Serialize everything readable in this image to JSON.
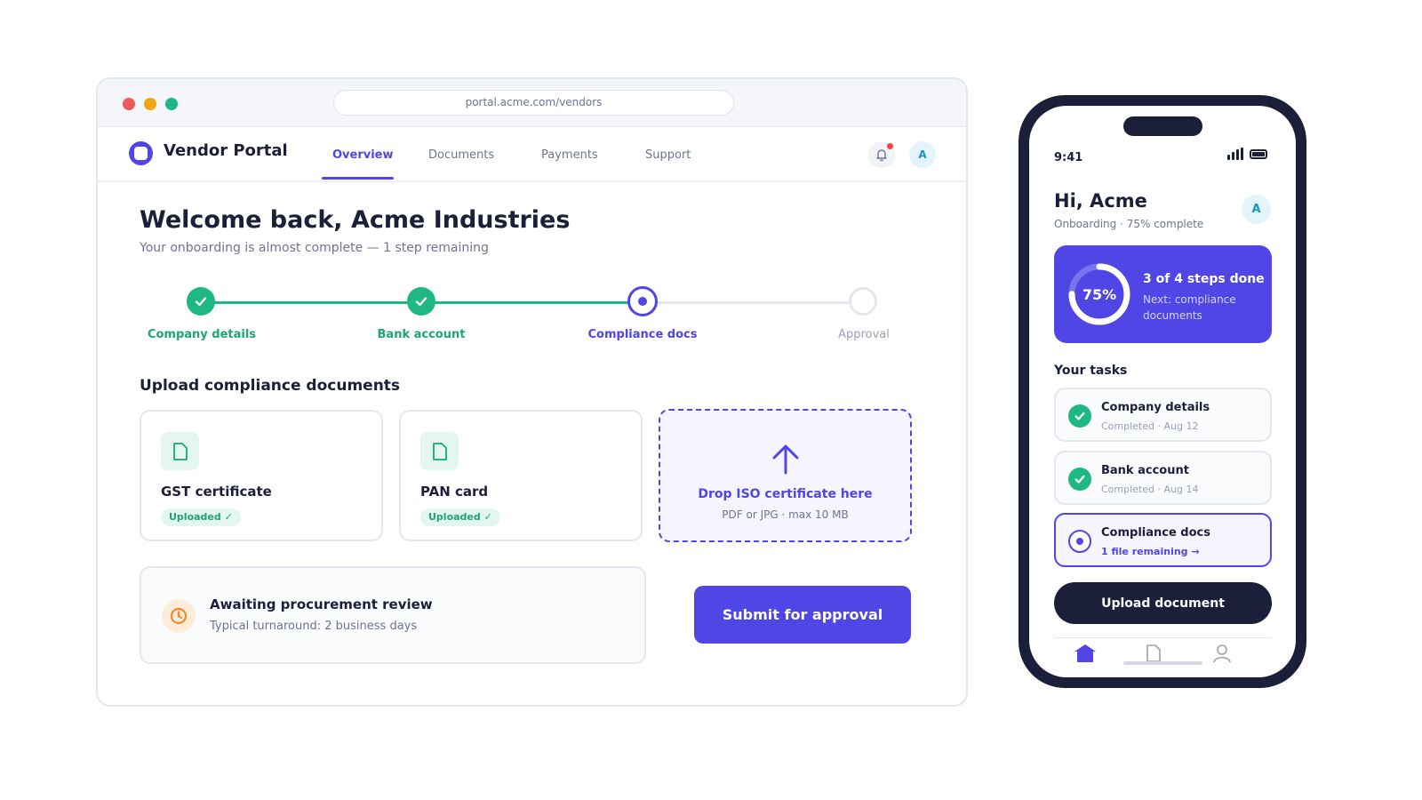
{
  "browser": {
    "url": "portal.acme.com/vendors",
    "brand": "Vendor Portal",
    "tabs": [
      {
        "label": "Overview",
        "active": true
      },
      {
        "label": "Documents",
        "active": false
      },
      {
        "label": "Payments",
        "active": false
      },
      {
        "label": "Support",
        "active": false
      }
    ],
    "avatar_initial": "A",
    "welcome": "Welcome back, Acme Industries",
    "subtitle": "Your onboarding is almost complete — 1 step remaining",
    "steps": [
      {
        "label": "Company details",
        "status": "done"
      },
      {
        "label": "Bank account",
        "status": "done"
      },
      {
        "label": "Compliance docs",
        "status": "current"
      },
      {
        "label": "Approval",
        "status": "todo"
      }
    ],
    "section_title": "Upload compliance documents",
    "documents": [
      {
        "name": "GST certificate",
        "badge": "Uploaded ✓",
        "icon": "document-icon"
      },
      {
        "name": "PAN card",
        "badge": "Uploaded ✓",
        "icon": "document-icon"
      }
    ],
    "dropzone": {
      "title": "Drop ISO certificate here",
      "hint": "PDF or JPG · max 10 MB",
      "icon": "upload-arrow-icon"
    },
    "status": {
      "title": "Awaiting procurement review",
      "subtitle": "Typical turnaround: 2 business days",
      "icon": "clock-icon"
    },
    "submit_label": "Submit for approval"
  },
  "phone": {
    "time": "9:41",
    "greeting": "Hi, Acme",
    "onboarding": "Onboarding · 75% complete",
    "avatar_initial": "A",
    "progress": {
      "percent_label": "75%",
      "fraction": 0.75,
      "title": "3 of 4 steps done",
      "next": "Next: compliance documents"
    },
    "tasks_title": "Your tasks",
    "tasks": [
      {
        "name": "Company details",
        "meta": "Completed · Aug 12",
        "status": "done"
      },
      {
        "name": "Bank account",
        "meta": "Completed · Aug 14",
        "status": "done"
      },
      {
        "name": "Compliance docs",
        "meta": "1 file remaining →",
        "status": "current"
      }
    ],
    "upload_label": "Upload document",
    "tabbar": [
      "home-icon",
      "document-icon",
      "profile-icon"
    ]
  },
  "colors": {
    "accent": "#4f46e5",
    "success": "#1fb784",
    "dark": "#1c1f3a",
    "warning": "#f08a24"
  }
}
